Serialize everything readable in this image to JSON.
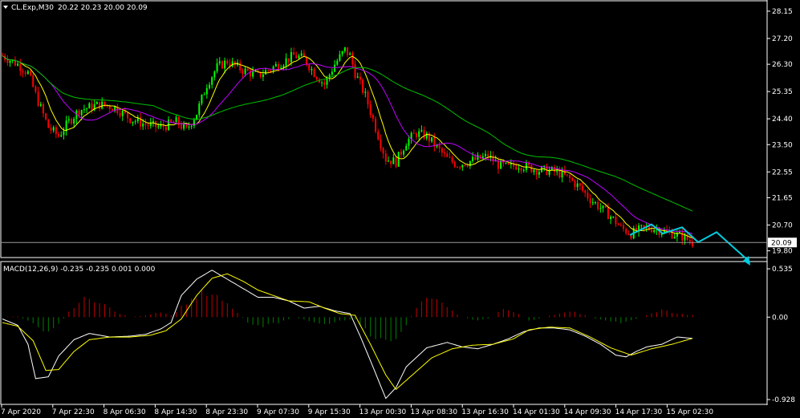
{
  "header": {
    "symbol_label": "CL.Exp,M30",
    "ohlc": "20.22 20.23 20.00 20.09"
  },
  "macd_panel": {
    "title": "MACD(12,26,9) -0.235 -0.235 0.001 0.000"
  },
  "colors": {
    "background": "#000000",
    "bull_candle": "#00ff00",
    "bear_candle": "#ff0000",
    "ma_fast": "#ffff00",
    "ma_mid": "#c000ff",
    "ma_slow": "#00c000",
    "macd_hist_up": "#c00000",
    "macd_hist_down": "#008000",
    "macd_line": "#ffffff",
    "signal_line": "#ffff00",
    "projection": "#00ccdd",
    "axis_text": "#ffffff"
  },
  "chart_data": {
    "type": "candlestick",
    "price_axis": {
      "ticks": [
        "28.15",
        "27.20",
        "26.30",
        "25.35",
        "24.40",
        "23.50",
        "22.55",
        "21.65",
        "20.70",
        "19.80"
      ],
      "current_price": "20.09",
      "range": [
        19.65,
        28.4
      ]
    },
    "time_labels": [
      "7 Apr 2020",
      "7 Apr 22:30",
      "8 Apr 06:30",
      "8 Apr 14:30",
      "8 Apr 23:30",
      "9 Apr 07:30",
      "9 Apr 15:30",
      "13 Apr 00:30",
      "13 Apr 08:30",
      "13 Apr 16:30",
      "14 Apr 01:30",
      "14 Apr 09:30",
      "14 Apr 17:30",
      "15 Apr 02:30"
    ],
    "price_path": [
      [
        0,
        26.6
      ],
      [
        6,
        26.3
      ],
      [
        10,
        26.0
      ],
      [
        14,
        25.0
      ],
      [
        18,
        24.1
      ],
      [
        22,
        23.8
      ],
      [
        26,
        24.3
      ],
      [
        30,
        24.7
      ],
      [
        38,
        24.9
      ],
      [
        44,
        24.8
      ],
      [
        50,
        24.4
      ],
      [
        56,
        24.2
      ],
      [
        62,
        24.1
      ],
      [
        68,
        24.3
      ],
      [
        72,
        24.0
      ],
      [
        76,
        24.6
      ],
      [
        80,
        25.6
      ],
      [
        84,
        26.2
      ],
      [
        88,
        26.4
      ],
      [
        94,
        26.1
      ],
      [
        100,
        25.9
      ],
      [
        104,
        26.1
      ],
      [
        110,
        26.4
      ],
      [
        114,
        26.6
      ],
      [
        118,
        26.5
      ],
      [
        122,
        26.0
      ],
      [
        126,
        25.6
      ],
      [
        130,
        26.3
      ],
      [
        134,
        26.8
      ],
      [
        136,
        26.6
      ],
      [
        138,
        26.0
      ],
      [
        142,
        25.2
      ],
      [
        146,
        24.1
      ],
      [
        150,
        23.0
      ],
      [
        154,
        22.9
      ],
      [
        158,
        23.6
      ],
      [
        162,
        23.9
      ],
      [
        166,
        23.8
      ],
      [
        170,
        23.4
      ],
      [
        174,
        23.0
      ],
      [
        178,
        22.8
      ],
      [
        182,
        22.9
      ],
      [
        186,
        23.0
      ],
      [
        190,
        23.1
      ],
      [
        194,
        22.8
      ],
      [
        198,
        22.7
      ],
      [
        202,
        22.8
      ],
      [
        206,
        22.7
      ],
      [
        210,
        22.6
      ],
      [
        214,
        22.6
      ],
      [
        218,
        22.5
      ],
      [
        222,
        22.3
      ],
      [
        226,
        22.0
      ],
      [
        230,
        21.6
      ],
      [
        234,
        21.3
      ],
      [
        238,
        21.0
      ],
      [
        242,
        20.6
      ],
      [
        246,
        20.4
      ],
      [
        250,
        20.55
      ],
      [
        254,
        20.6
      ],
      [
        258,
        20.5
      ],
      [
        262,
        20.4
      ],
      [
        266,
        20.3
      ],
      [
        270,
        20.09
      ]
    ],
    "candle_count": 271,
    "projection_path": [
      [
        20.35,
        20.72
      ],
      [
        20.6,
        20.4
      ],
      [
        20.75,
        20.62
      ],
      [
        20.3,
        20.1
      ],
      [
        20.75,
        20.45
      ],
      [
        19.4
      ]
    ],
    "macd": {
      "axis_ticks": [
        "0.535",
        "0.00",
        "-0.928"
      ],
      "range": [
        -0.93,
        0.58
      ],
      "macd_path": [
        [
          0,
          -0.02
        ],
        [
          6,
          -0.09
        ],
        [
          10,
          -0.3
        ],
        [
          13,
          -0.68
        ],
        [
          18,
          -0.66
        ],
        [
          22,
          -0.43
        ],
        [
          28,
          -0.25
        ],
        [
          34,
          -0.18
        ],
        [
          42,
          -0.22
        ],
        [
          50,
          -0.21
        ],
        [
          56,
          -0.19
        ],
        [
          62,
          -0.13
        ],
        [
          66,
          -0.06
        ],
        [
          70,
          0.24
        ],
        [
          76,
          0.42
        ],
        [
          82,
          0.52
        ],
        [
          88,
          0.42
        ],
        [
          94,
          0.32
        ],
        [
          100,
          0.22
        ],
        [
          106,
          0.22
        ],
        [
          112,
          0.18
        ],
        [
          118,
          0.1
        ],
        [
          124,
          0.12
        ],
        [
          130,
          0.07
        ],
        [
          136,
          0.04
        ],
        [
          140,
          -0.21
        ],
        [
          146,
          -0.62
        ],
        [
          150,
          -0.9
        ],
        [
          154,
          -0.78
        ],
        [
          158,
          -0.55
        ],
        [
          166,
          -0.34
        ],
        [
          174,
          -0.28
        ],
        [
          180,
          -0.33
        ],
        [
          186,
          -0.35
        ],
        [
          192,
          -0.3
        ],
        [
          198,
          -0.24
        ],
        [
          204,
          -0.16
        ],
        [
          210,
          -0.12
        ],
        [
          216,
          -0.12
        ],
        [
          222,
          -0.14
        ],
        [
          228,
          -0.21
        ],
        [
          234,
          -0.3
        ],
        [
          240,
          -0.42
        ],
        [
          244,
          -0.44
        ],
        [
          248,
          -0.38
        ],
        [
          252,
          -0.33
        ],
        [
          258,
          -0.3
        ],
        [
          264,
          -0.22
        ],
        [
          270,
          -0.235
        ]
      ],
      "signal_path": [
        [
          0,
          -0.06
        ],
        [
          6,
          -0.1
        ],
        [
          12,
          -0.26
        ],
        [
          17,
          -0.59
        ],
        [
          22,
          -0.58
        ],
        [
          28,
          -0.38
        ],
        [
          34,
          -0.25
        ],
        [
          42,
          -0.22
        ],
        [
          50,
          -0.22
        ],
        [
          58,
          -0.2
        ],
        [
          64,
          -0.15
        ],
        [
          70,
          -0.02
        ],
        [
          76,
          0.24
        ],
        [
          82,
          0.43
        ],
        [
          88,
          0.48
        ],
        [
          94,
          0.4
        ],
        [
          100,
          0.3
        ],
        [
          106,
          0.24
        ],
        [
          112,
          0.18
        ],
        [
          120,
          0.17
        ],
        [
          126,
          0.1
        ],
        [
          132,
          0.04
        ],
        [
          138,
          0.02
        ],
        [
          144,
          -0.3
        ],
        [
          150,
          -0.64
        ],
        [
          154,
          -0.8
        ],
        [
          160,
          -0.65
        ],
        [
          168,
          -0.45
        ],
        [
          176,
          -0.35
        ],
        [
          184,
          -0.31
        ],
        [
          192,
          -0.3
        ],
        [
          200,
          -0.24
        ],
        [
          206,
          -0.14
        ],
        [
          214,
          -0.11
        ],
        [
          222,
          -0.12
        ],
        [
          230,
          -0.22
        ],
        [
          238,
          -0.34
        ],
        [
          246,
          -0.42
        ],
        [
          254,
          -0.35
        ],
        [
          262,
          -0.3
        ],
        [
          270,
          -0.235
        ]
      ],
      "histogram_path": [
        [
          0,
          0.0
        ],
        [
          6,
          0.01
        ],
        [
          12,
          -0.06
        ],
        [
          17,
          -0.16
        ],
        [
          22,
          -0.08
        ],
        [
          28,
          0.12
        ],
        [
          32,
          0.2
        ],
        [
          38,
          0.18
        ],
        [
          44,
          0.06
        ],
        [
          50,
          0.0
        ],
        [
          56,
          0.02
        ],
        [
          62,
          0.06
        ],
        [
          66,
          0.02
        ],
        [
          72,
          0.16
        ],
        [
          78,
          0.26
        ],
        [
          84,
          0.22
        ],
        [
          90,
          0.1
        ],
        [
          96,
          -0.06
        ],
        [
          102,
          -0.1
        ],
        [
          108,
          -0.06
        ],
        [
          114,
          0.0
        ],
        [
          120,
          -0.04
        ],
        [
          126,
          -0.08
        ],
        [
          132,
          -0.04
        ],
        [
          138,
          -0.02
        ],
        [
          144,
          -0.2
        ],
        [
          150,
          -0.28
        ],
        [
          154,
          -0.24
        ],
        [
          158,
          -0.08
        ],
        [
          164,
          0.2
        ],
        [
          168,
          0.24
        ],
        [
          174,
          0.1
        ],
        [
          180,
          0.0
        ],
        [
          186,
          -0.04
        ],
        [
          192,
          0.0
        ],
        [
          196,
          0.1
        ],
        [
          202,
          0.04
        ],
        [
          206,
          -0.04
        ],
        [
          212,
          0.0
        ],
        [
          218,
          0.04
        ],
        [
          224,
          0.06
        ],
        [
          230,
          0.0
        ],
        [
          236,
          -0.04
        ],
        [
          242,
          -0.06
        ],
        [
          248,
          -0.02
        ],
        [
          254,
          0.04
        ],
        [
          258,
          0.08
        ],
        [
          264,
          0.04
        ],
        [
          270,
          0.02
        ]
      ]
    }
  }
}
